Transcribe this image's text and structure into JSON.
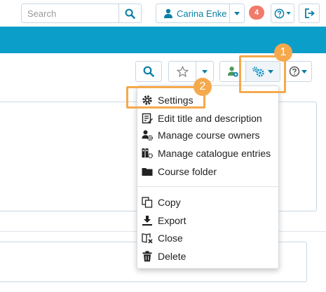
{
  "top_nav": {
    "search_placeholder": "Search",
    "user_name": "Carina Enke",
    "notification_count": "4"
  },
  "toolbar": {
    "icons": [
      "search-icon",
      "star-icon",
      "course-owner-icon",
      "gear-icon",
      "help-icon"
    ]
  },
  "settings_menu": {
    "primary_items": [
      {
        "label": "Settings",
        "icon": "gear-icon"
      },
      {
        "label": "Edit title and description",
        "icon": "edit-icon"
      },
      {
        "label": "Manage course owners",
        "icon": "owner-settings-icon"
      },
      {
        "label": "Manage catalogue entries",
        "icon": "catalogue-icon"
      },
      {
        "label": "Course folder",
        "icon": "folder-icon"
      }
    ],
    "secondary_items": [
      {
        "label": "Copy",
        "icon": "copy-icon"
      },
      {
        "label": "Export",
        "icon": "download-icon"
      },
      {
        "label": "Close",
        "icon": "close-book-icon"
      },
      {
        "label": "Delete",
        "icon": "trash-icon"
      }
    ]
  },
  "callouts": {
    "step1": "1",
    "step2": "2",
    "color": "#f5a94c"
  },
  "colors": {
    "brand_band": "#0a9ec9",
    "notification_badge": "#f27a6b",
    "link_text": "#0a7fa6"
  }
}
